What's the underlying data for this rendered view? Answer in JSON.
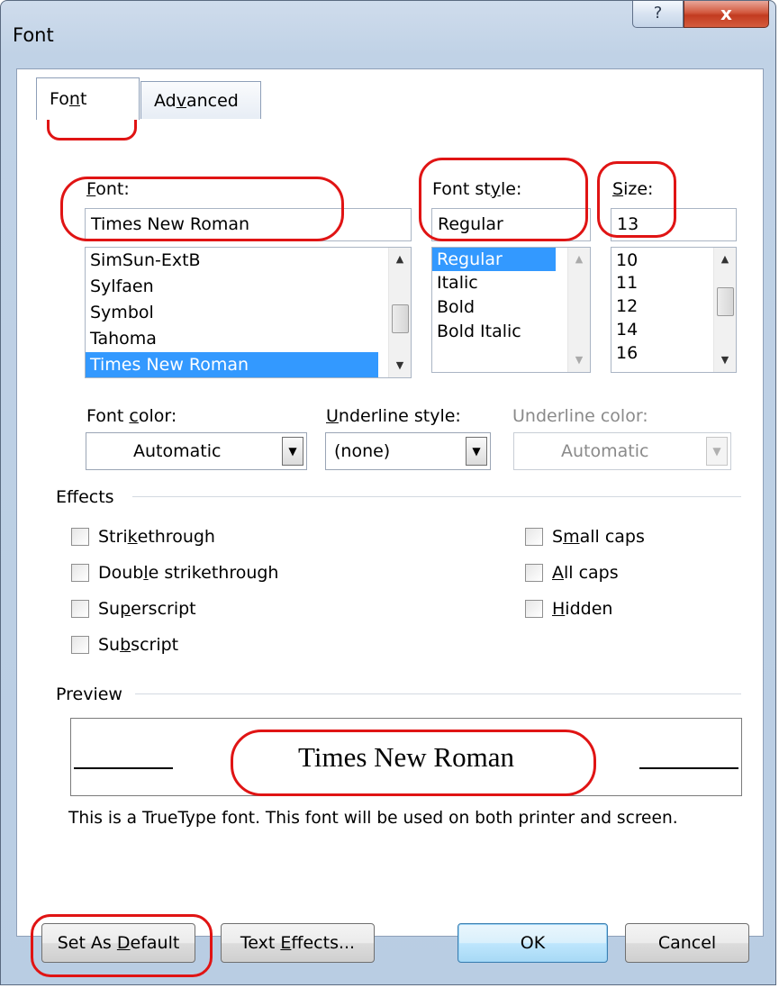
{
  "window": {
    "title": "Font",
    "help_label": "?",
    "close_label": "x"
  },
  "tabs": [
    {
      "label_pre": "Fo",
      "label_key": "n",
      "label_post": "t"
    },
    {
      "label_pre": "Ad",
      "label_key": "v",
      "label_post": "anced"
    }
  ],
  "font": {
    "label_key": "F",
    "label_post": "ont:",
    "value": "Times New Roman",
    "items": [
      "SimSun-ExtB",
      "Sylfaen",
      "Symbol",
      "Tahoma",
      "Times New Roman"
    ],
    "selected": "Times New Roman"
  },
  "style": {
    "label_pre": "Font st",
    "label_key": "y",
    "label_post": "le:",
    "value": "Regular",
    "items": [
      "Regular",
      "Italic",
      "Bold",
      "Bold Italic"
    ],
    "selected": "Regular"
  },
  "size": {
    "label_key": "S",
    "label_post": "ize:",
    "value": "13",
    "items": [
      "10",
      "11",
      "12",
      "14",
      "16"
    ]
  },
  "font_color": {
    "label_pre": "Font ",
    "label_key": "c",
    "label_post": "olor:",
    "value": "Automatic"
  },
  "underline_style": {
    "label_key": "U",
    "label_post": "nderline style:",
    "value": "(none)"
  },
  "underline_color": {
    "label": "Underline color:",
    "value": "Automatic"
  },
  "effects": {
    "heading": "Effects",
    "left": [
      {
        "pre": "Stri",
        "key": "k",
        "post": "ethrough"
      },
      {
        "pre": "Doub",
        "key": "l",
        "post": "e strikethrough"
      },
      {
        "pre": "Su",
        "key": "p",
        "post": "erscript"
      },
      {
        "pre": "Su",
        "key": "b",
        "post": "script"
      }
    ],
    "right": [
      {
        "pre": "S",
        "key": "m",
        "post": "all caps"
      },
      {
        "pre": "",
        "key": "A",
        "post": "ll caps"
      },
      {
        "pre": "",
        "key": "H",
        "post": "idden"
      }
    ]
  },
  "preview": {
    "heading": "Preview",
    "sample": "Times New Roman",
    "note": "This is a TrueType font. This font will be used on both printer and screen."
  },
  "buttons": {
    "set_default": {
      "pre": "Set As ",
      "key": "D",
      "post": "efault"
    },
    "text_effects": {
      "pre": "Text ",
      "key": "E",
      "post": "ffects..."
    },
    "ok": "OK",
    "cancel": "Cancel"
  },
  "colors": {
    "selection": "#3399ff",
    "annotation": "#e01414",
    "default_button": "#bee6fd"
  }
}
